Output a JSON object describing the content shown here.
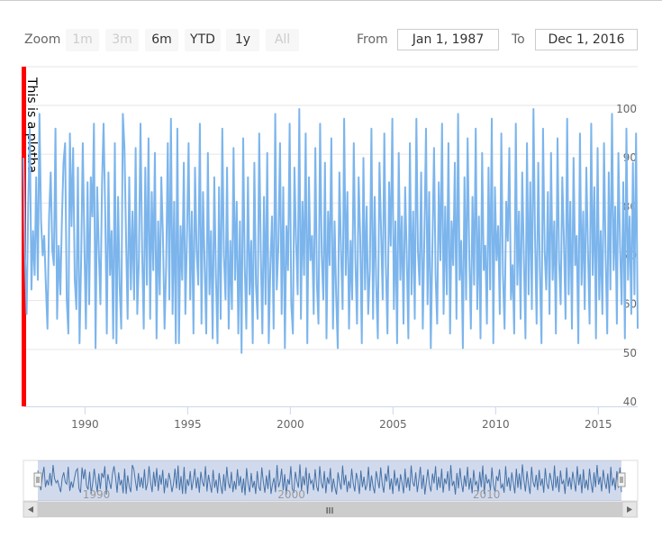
{
  "range_selector": {
    "zoom_label": "Zoom",
    "buttons": [
      {
        "label": "1m",
        "enabled": false
      },
      {
        "label": "3m",
        "enabled": false
      },
      {
        "label": "6m",
        "enabled": true
      },
      {
        "label": "YTD",
        "enabled": true
      },
      {
        "label": "1y",
        "enabled": true
      },
      {
        "label": "All",
        "enabled": false
      }
    ]
  },
  "input_group": {
    "from_label": "From",
    "from_value": "Jan 1, 1987",
    "to_label": "To",
    "to_value": "Dec 1, 2016"
  },
  "plot_band": {
    "label": "This is a plotba",
    "color": "#ff0000"
  },
  "scrollbar": {
    "thumb_grip": "III"
  },
  "chart_data": {
    "type": "line",
    "x_range": [
      "1987-01",
      "2016-12"
    ],
    "x_step": "monthly",
    "ylim": [
      40,
      100
    ],
    "y_ticks": [
      40,
      50,
      60,
      70,
      80,
      90,
      100
    ],
    "x_ticks": [
      1990,
      1995,
      2000,
      2005,
      2010,
      2015
    ],
    "navigator_x_ticks": [
      1990,
      2000,
      2010
    ],
    "grid": true,
    "legend": "none",
    "line_color": "#7cb5ec",
    "navigator_line_color": "#4572a7",
    "series": [
      {
        "values": [
          90,
          70,
          58,
          80,
          96,
          63,
          75,
          66,
          86,
          65,
          99,
          77,
          70,
          74,
          64,
          55,
          78,
          87,
          71,
          68,
          96,
          57,
          72,
          62,
          77,
          89,
          93,
          61,
          54,
          95,
          76,
          92,
          65,
          59,
          88,
          52,
          69,
          93,
          72,
          55,
          85,
          60,
          86,
          78,
          97,
          51,
          84,
          71,
          60,
          85,
          97,
          79,
          54,
          87,
          66,
          75,
          53,
          93,
          52,
          82,
          64,
          55,
          99,
          92,
          73,
          57,
          86,
          63,
          79,
          61,
          92,
          58,
          69,
          97,
          71,
          55,
          88,
          64,
          94,
          57,
          83,
          67,
          91,
          53,
          77,
          62,
          86,
          74,
          55,
          68,
          93,
          61,
          98,
          58,
          81,
          52,
          96,
          52,
          76,
          65,
          89,
          58,
          74,
          93,
          61,
          79,
          54,
          88,
          71,
          64,
          97,
          56,
          83,
          68,
          54,
          91,
          62,
          75,
          53,
          86,
          66,
          52,
          84,
          57,
          96,
          70,
          61,
          88,
          55,
          73,
          59,
          92,
          65,
          81,
          54,
          77,
          50,
          94,
          68,
          55,
          86,
          62,
          73,
          52,
          89,
          64,
          57,
          95,
          71,
          54,
          82,
          60,
          91,
          52,
          68,
          78,
          55,
          99,
          63,
          72,
          93,
          58,
          84,
          51,
          76,
          67,
          97,
          60,
          54,
          88,
          73,
          62,
          100,
          57,
          81,
          66,
          95,
          52,
          86,
          69,
          74,
          58,
          92,
          64,
          56,
          97,
          70,
          61,
          89,
          53,
          79,
          68,
          94,
          55,
          77,
          62,
          51,
          87,
          71,
          59,
          98,
          66,
          83,
          55,
          73,
          61,
          93,
          69,
          56,
          86,
          74,
          52,
          90,
          63,
          80,
          58,
          67,
          96,
          57,
          82,
          64,
          53,
          89,
          75,
          61,
          95,
          68,
          54,
          85,
          72,
          98,
          59,
          77,
          52,
          91,
          65,
          78,
          56,
          84,
          70,
          53,
          93,
          62,
          79,
          57,
          98,
          71,
          64,
          87,
          55,
          74,
          96,
          60,
          83,
          51,
          72,
          92,
          66,
          56,
          85,
          69,
          97,
          58,
          80,
          62,
          93,
          54,
          77,
          68,
          89,
          57,
          99,
          65,
          73,
          51,
          86,
          61,
          94,
          70,
          55,
          82,
          64,
          96,
          59,
          78,
          53,
          91,
          67,
          72,
          56,
          88,
          63,
          98,
          52,
          84,
          69,
          76,
          58,
          95,
          66,
          55,
          81,
          73,
          92,
          61,
          68,
          54,
          97,
          64,
          79,
          57,
          87,
          70,
          53,
          93,
          62,
          85,
          59,
          100,
          74,
          56,
          89,
          67,
          52,
          96,
          71,
          63,
          83,
          58,
          91,
          65,
          77,
          54,
          94,
          69,
          60,
          86,
          73,
          57,
          98,
          62,
          81,
          55,
          90,
          68,
          74,
          52,
          95,
          64,
          79,
          59,
          88,
          71,
          56,
          97,
          66,
          84,
          53,
          92,
          61,
          75,
          58,
          93,
          70,
          54,
          87,
          63,
          99,
          67,
          80,
          56,
          91,
          72,
          60,
          85,
          53,
          96,
          65,
          78,
          58,
          89,
          62,
          95,
          55
        ]
      }
    ]
  }
}
